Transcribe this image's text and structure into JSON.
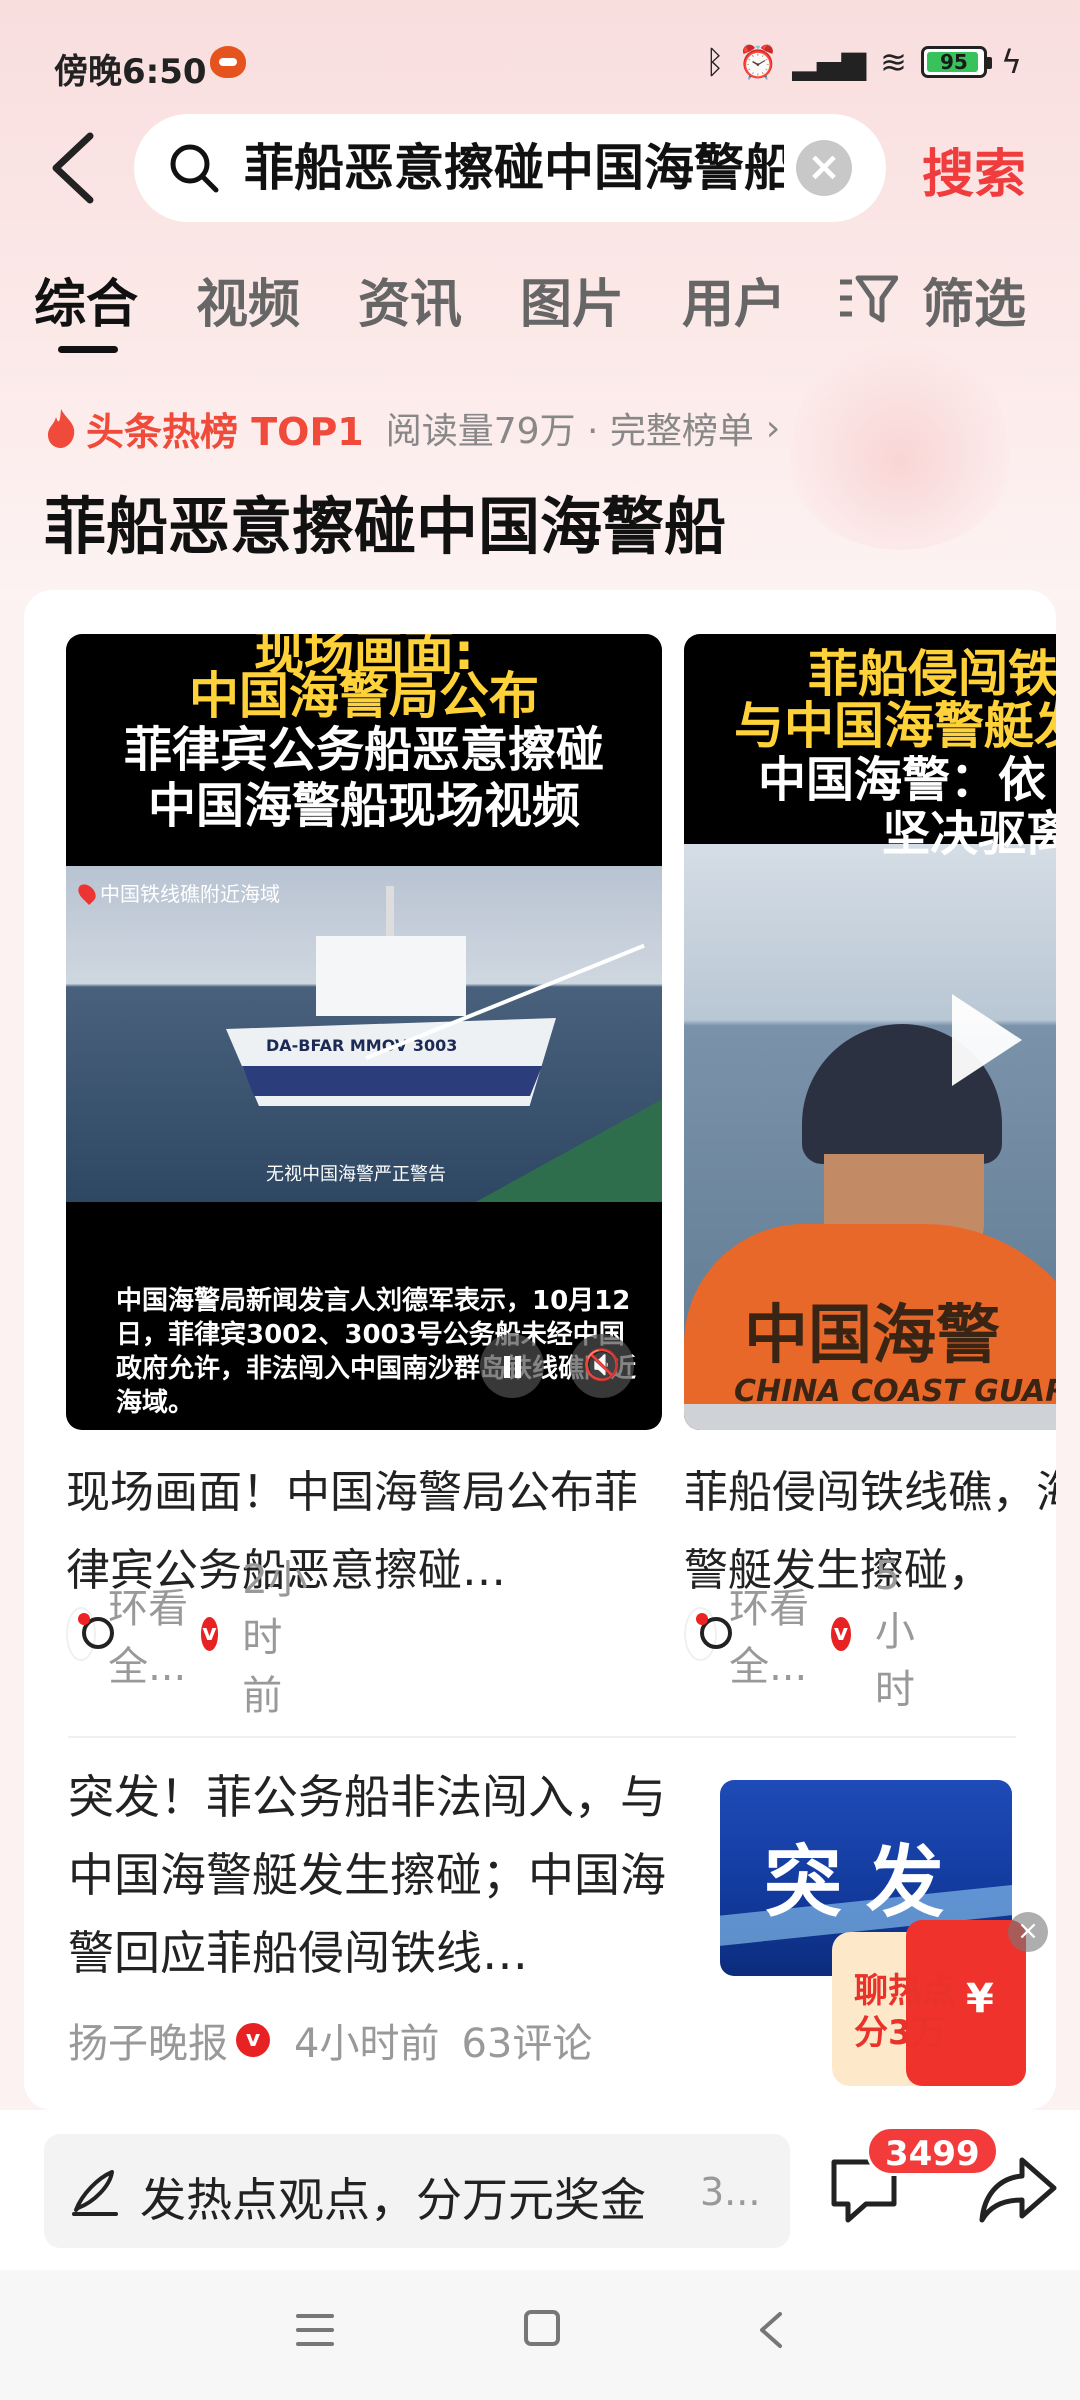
{
  "status_bar": {
    "time": "傍晚6:50",
    "battery": "95"
  },
  "search": {
    "query": "菲船恶意擦碰中国海警船",
    "button_label": "搜索"
  },
  "tabs": [
    {
      "label": "综合"
    },
    {
      "label": "视频"
    },
    {
      "label": "资讯"
    },
    {
      "label": "图片"
    },
    {
      "label": "用户"
    },
    {
      "label": "筛选"
    }
  ],
  "hot": {
    "label": "头条热榜 TOP1",
    "meta": "阅读量79万 · 完整榜单",
    "topic_title": "菲船恶意擦碰中国海警船"
  },
  "videos": [
    {
      "caption_lines": [
        "现场画面:",
        "中国海警局公布",
        "菲律宾公务船恶意擦碰",
        "中国海警船现场视频"
      ],
      "location_tag": "中国铁线礁附近海域",
      "ship_registration": "DA-BFAR MMOV 3003",
      "watermark": "无视中国海警严正警告",
      "subtitle": "中国海警局新闻发言人刘德军表示，10月12日，菲律宾3002、3003号公务船未经中国政府允许，非法闯入中国南沙群岛铁线礁附近海域。",
      "title": "现场画面！中国海警局公布菲律宾公务船恶意擦碰…",
      "author": "环看全...",
      "time": "2小时前"
    },
    {
      "caption_lines": [
        "菲船侵闯铁",
        "与中国海警艇发",
        "中国海警：依",
        "坚决驱离"
      ],
      "vest_text": "中国海警",
      "vest_text_en": "CHINA COAST GUARD",
      "title": "菲船侵闯铁线礁，海警艇发生擦碰，",
      "author": "环看全...",
      "time": "5小时"
    }
  ],
  "article": {
    "title": "突发！菲公务船非法闯入，与中国海警艇发生擦碰；中国海警回应菲船侵闯铁线…",
    "source": "扬子晚报",
    "time": "4小时前",
    "comments": "63评论",
    "thumb_text": "突发"
  },
  "red_packet": {
    "text": "聊热点分3万",
    "yen": "¥"
  },
  "comment_bar": {
    "placeholder": "发热点观点，分万元奖金",
    "extra": "3...",
    "badge_count": "3499"
  },
  "colors": {
    "accent": "#f03c3c",
    "hot": "#f04a3a",
    "verified": "#e82222"
  }
}
